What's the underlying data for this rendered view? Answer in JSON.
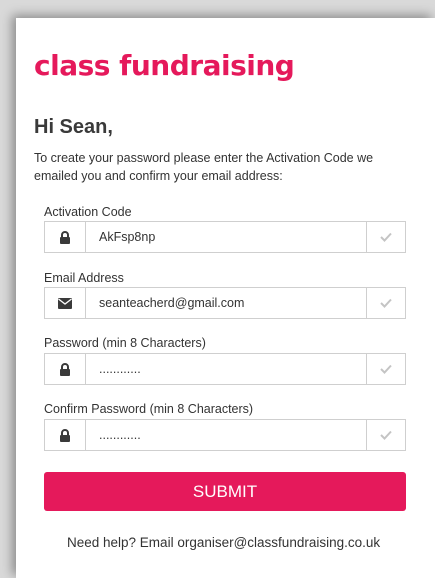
{
  "brand": {
    "name": "class fundraising",
    "accent": "#e5195b"
  },
  "greeting": "Hi Sean,",
  "intro": "To create your password please enter the Activation Code we emailed you and confirm your email address:",
  "fields": [
    {
      "label": "Activation Code",
      "value": "AkFsp8np",
      "icon": "lock-icon"
    },
    {
      "label": "Email Address",
      "value": "seanteacherd@gmail.com",
      "icon": "envelope-icon"
    },
    {
      "label": "Password (min 8 Characters)",
      "value": "............",
      "icon": "lock-icon"
    },
    {
      "label": "Confirm Password (min 8 Characters)",
      "value": "............",
      "icon": "lock-icon"
    }
  ],
  "submit_label": "SUBMIT",
  "help_text": "Need help? Email organiser@classfundraising.co.uk"
}
